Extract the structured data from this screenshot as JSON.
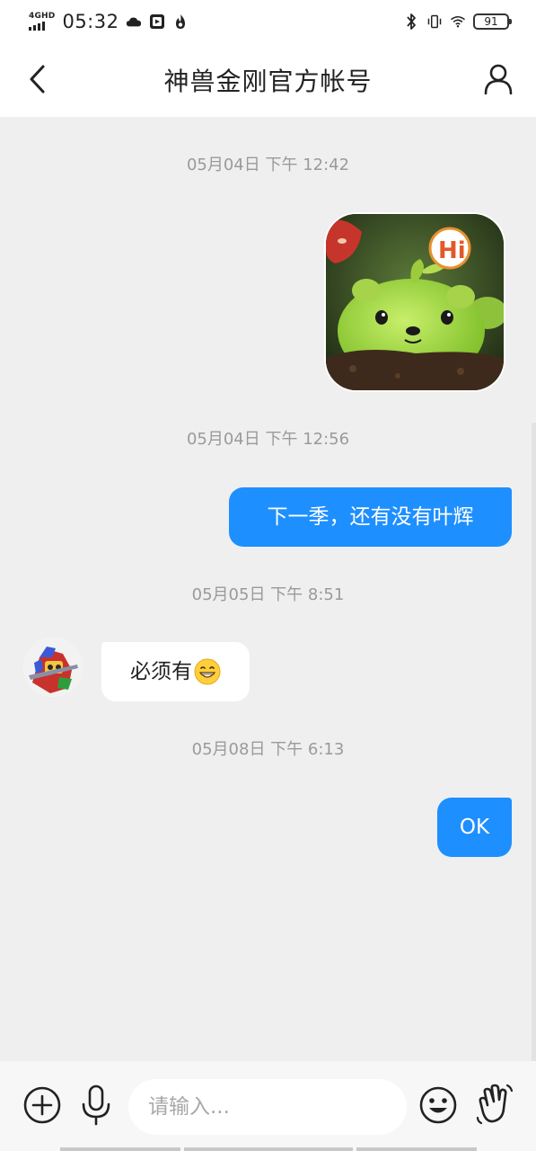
{
  "status_bar": {
    "network_type": "4GHD",
    "time": "05:32",
    "battery_level": "91",
    "left_icons": [
      "cloud-icon",
      "media-icon",
      "flame-icon"
    ],
    "right_icons": [
      "bluetooth-icon",
      "vibrate-icon",
      "wifi-icon",
      "battery-icon"
    ]
  },
  "header": {
    "title": "神兽金刚官方帐号",
    "back_icon": "chevron-left-icon",
    "profile_icon": "user-icon"
  },
  "messages": [
    {
      "timestamp": "05月04日 下午 12:42",
      "direction": "sent",
      "type": "sticker",
      "sticker_text": "Hi"
    },
    {
      "timestamp": "05月04日 下午 12:56",
      "direction": "sent",
      "type": "text",
      "text": "下一季，还有没有叶辉"
    },
    {
      "timestamp": "05月05日 下午 8:51",
      "direction": "received",
      "type": "text",
      "text": "必须有",
      "emoji": "grinning-face-icon"
    },
    {
      "timestamp": "05月08日 下午 6:13",
      "direction": "sent",
      "type": "text",
      "text": "OK"
    }
  ],
  "input_bar": {
    "placeholder": "请输入...",
    "value": "",
    "buttons": [
      "plus-icon",
      "microphone-icon",
      "emoji-icon",
      "wave-hand-icon"
    ]
  },
  "colors": {
    "sent_bubble": "#1e8fff",
    "received_bubble": "#ffffff",
    "chat_background": "#efefef",
    "timestamp_text": "#9a9a9a"
  }
}
